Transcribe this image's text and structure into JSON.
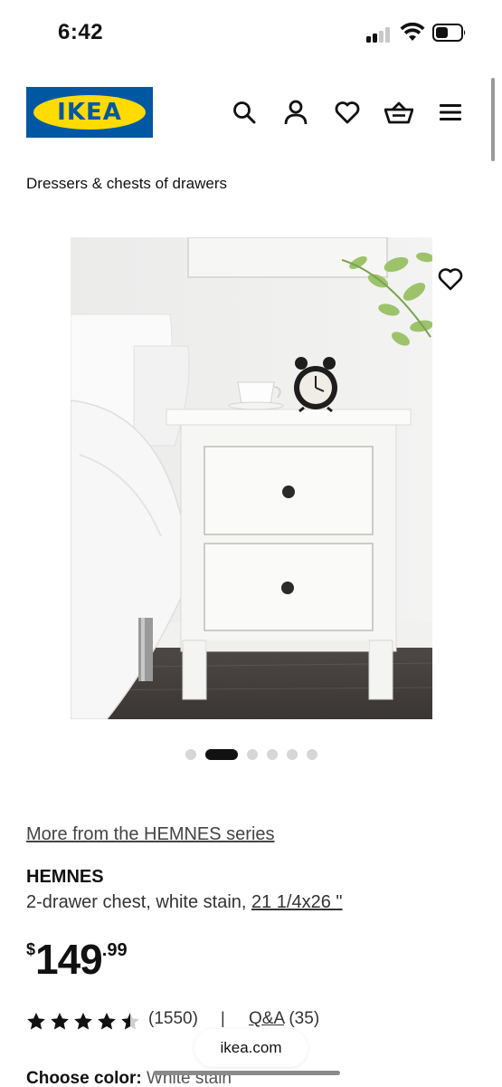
{
  "status_bar": {
    "time": "6:42"
  },
  "header": {
    "logo_text": "IKEA",
    "icons": [
      "search-icon",
      "account-icon",
      "heart-icon",
      "basket-icon",
      "menu-icon"
    ]
  },
  "breadcrumb": "Dressers & chests of drawers",
  "carousel": {
    "total_images": 6,
    "active_index": 1
  },
  "product": {
    "series_link": "More from the HEMNES series",
    "name": "HEMNES",
    "description": "2-drawer chest, white stain,",
    "size_link": "21 1/4x26 \"",
    "price": {
      "currency": "$",
      "whole": "149",
      "cents": ".99"
    },
    "rating": {
      "stars": 4.5,
      "review_count": "(1550)",
      "separator": "|",
      "qa_label": "Q&A",
      "qa_count": "(35)"
    },
    "color": {
      "label": "Choose color:",
      "value": "White stain"
    }
  },
  "browser": {
    "url": "ikea.com"
  },
  "colors": {
    "ikea_blue": "#0058a3",
    "ikea_yellow": "#ffdb00",
    "text": "#111111"
  }
}
